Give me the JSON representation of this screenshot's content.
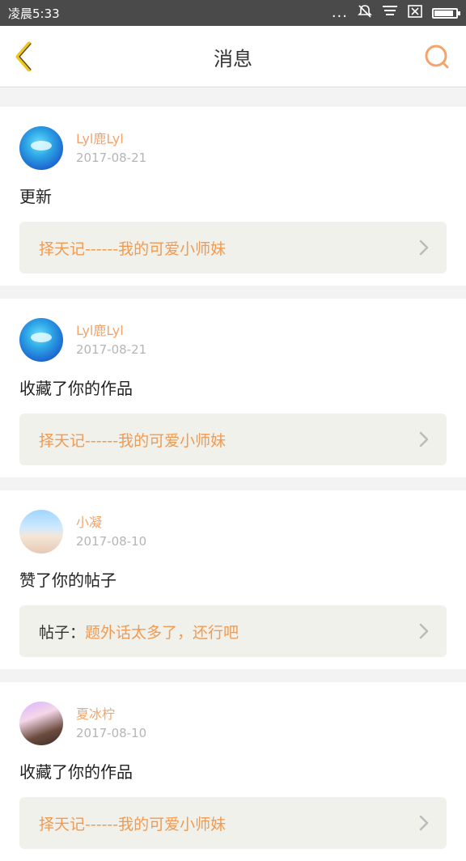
{
  "status_bar": {
    "time": "凌晨5:33",
    "dots": "..."
  },
  "header": {
    "title": "消息"
  },
  "messages": [
    {
      "author": "Lyl鹿Lyl",
      "date": "2017-08-21",
      "action": "更新",
      "ref_prefix": "",
      "ref_text": "择天记------我的可爱小师妹"
    },
    {
      "author": "Lyl鹿Lyl",
      "date": "2017-08-21",
      "action": "收藏了你的作品",
      "ref_prefix": "",
      "ref_text": "择天记------我的可爱小师妹"
    },
    {
      "author": "小凝",
      "date": "2017-08-10",
      "action": "赞了你的帖子",
      "ref_prefix": "帖子：",
      "ref_text": "题外话太多了，还行吧"
    },
    {
      "author": "夏冰柠",
      "date": "2017-08-10",
      "action": "收藏了你的作品",
      "ref_prefix": "",
      "ref_text": "择天记------我的可爱小师妹"
    }
  ],
  "colors": {
    "accent": "#f4a46b",
    "ref_text": "#f19a52",
    "status_bar": "#4a4a4a",
    "back_icon": "#f0c419",
    "search_icon": "#f4a46b"
  }
}
